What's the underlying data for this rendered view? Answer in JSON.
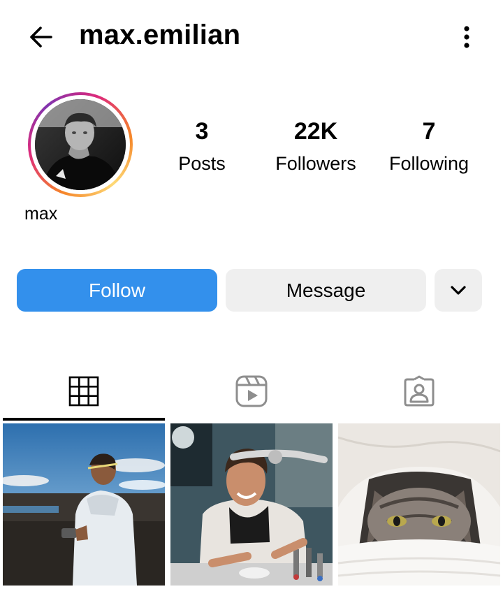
{
  "header": {
    "username": "max.emilian",
    "back_icon": "arrow-left-icon",
    "more_icon": "more-vertical-icon"
  },
  "profile": {
    "display_name": "max",
    "avatar": "profile-photo",
    "stats": [
      {
        "value": "3",
        "label": "Posts"
      },
      {
        "value": "22K",
        "label": "Followers"
      },
      {
        "value": "7",
        "label": "Following"
      }
    ]
  },
  "actions": {
    "follow_label": "Follow",
    "message_label": "Message",
    "more_icon": "chevron-down-icon"
  },
  "colors": {
    "accent": "#3390ec",
    "button_secondary": "#efefef",
    "text": "#000000"
  },
  "tabs": [
    {
      "icon": "grid-icon",
      "active": true
    },
    {
      "icon": "reels-icon",
      "active": false
    },
    {
      "icon": "tagged-icon",
      "active": false
    }
  ],
  "posts": [
    {
      "thumbnail": "man-in-hoodie-outdoors"
    },
    {
      "thumbnail": "man-at-workbench-smiling"
    },
    {
      "thumbnail": "cat-under-blanket"
    }
  ]
}
